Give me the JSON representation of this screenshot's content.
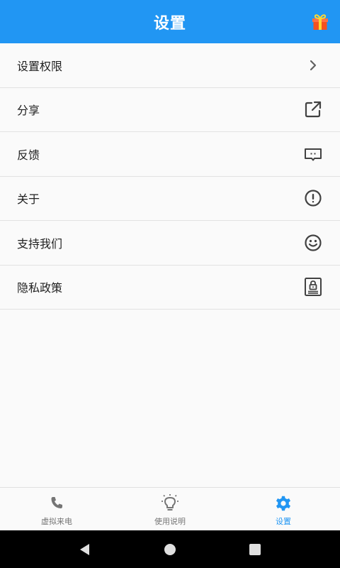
{
  "app_bar": {
    "title": "设置",
    "gift_icon": "gift-icon",
    "color": "#2196f3"
  },
  "menu": {
    "items": [
      {
        "label": "设置权限",
        "icon": "chevron-right-icon"
      },
      {
        "label": "分享",
        "icon": "share-external-icon"
      },
      {
        "label": "反馈",
        "icon": "feedback-message-icon"
      },
      {
        "label": "关于",
        "icon": "info-exclamation-icon"
      },
      {
        "label": "支持我们",
        "icon": "smiley-face-icon"
      },
      {
        "label": "隐私政策",
        "icon": "privacy-lock-icon"
      }
    ]
  },
  "bottom_nav": {
    "tabs": [
      {
        "label": "虚拟来电",
        "icon": "phone-icon",
        "active": false
      },
      {
        "label": "使用说明",
        "icon": "lightbulb-icon",
        "active": false
      },
      {
        "label": "设置",
        "icon": "gear-icon",
        "active": true
      }
    ],
    "active_color": "#2196f3",
    "inactive_color": "#757575"
  },
  "system_nav": {
    "buttons": [
      "back-icon",
      "home-icon",
      "recents-icon"
    ]
  }
}
